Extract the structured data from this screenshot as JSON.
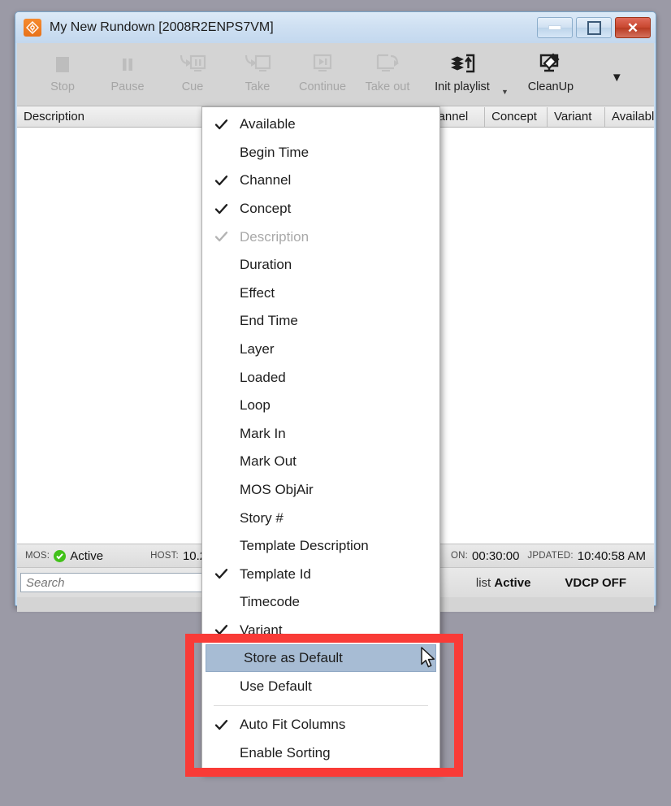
{
  "window": {
    "title": "My New Rundown [2008R2ENPS7VM]",
    "icon": "app-logo-icon",
    "controls": {
      "minimize": "minimize-button",
      "maximize": "maximize-button",
      "close": "close-button"
    }
  },
  "toolbar": {
    "items": [
      {
        "label": "Stop",
        "icon": "stop-icon",
        "enabled": false
      },
      {
        "label": "Pause",
        "icon": "pause-icon",
        "enabled": false
      },
      {
        "label": "Cue",
        "icon": "cue-icon",
        "enabled": false
      },
      {
        "label": "Take",
        "icon": "take-icon",
        "enabled": false
      },
      {
        "label": "Continue",
        "icon": "continue-icon",
        "enabled": false
      },
      {
        "label": "Take out",
        "icon": "take-out-icon",
        "enabled": false
      },
      {
        "label": "Init playlist",
        "icon": "init-playlist-icon",
        "enabled": true
      },
      {
        "label": "CleanUp",
        "icon": "cleanup-icon",
        "enabled": true
      }
    ],
    "overflow_caret": "▼",
    "small_caret": "▼"
  },
  "grid": {
    "columns": [
      "Description",
      "Channel",
      "Concept",
      "Variant",
      "Available"
    ],
    "rows": []
  },
  "status": {
    "mos_key": "MOS:",
    "mos_value": "Active",
    "mos_icon": "green-check-icon",
    "host_key": "HOST:",
    "host_value": "10.2",
    "duration_key": "ON:",
    "duration_value": "00:30:00",
    "updated_key": "JPDATED:",
    "updated_value": "10:40:58 AM"
  },
  "search": {
    "placeholder": "Search",
    "value": "",
    "playlist_prefix": "list",
    "playlist_state": "Active",
    "vdcp_state": "VDCP OFF"
  },
  "context_menu": {
    "items": [
      {
        "label": "Available",
        "checked": true,
        "dim": false
      },
      {
        "label": "Begin Time",
        "checked": false,
        "dim": false
      },
      {
        "label": "Channel",
        "checked": true,
        "dim": false
      },
      {
        "label": "Concept",
        "checked": true,
        "dim": false
      },
      {
        "label": "Description",
        "checked": true,
        "dim": true
      },
      {
        "label": "Duration",
        "checked": false,
        "dim": false
      },
      {
        "label": "Effect",
        "checked": false,
        "dim": false
      },
      {
        "label": "End Time",
        "checked": false,
        "dim": false
      },
      {
        "label": "Layer",
        "checked": false,
        "dim": false
      },
      {
        "label": "Loaded",
        "checked": false,
        "dim": false
      },
      {
        "label": "Loop",
        "checked": false,
        "dim": false
      },
      {
        "label": "Mark In",
        "checked": false,
        "dim": false
      },
      {
        "label": "Mark Out",
        "checked": false,
        "dim": false
      },
      {
        "label": "MOS ObjAir",
        "checked": false,
        "dim": false
      },
      {
        "label": "Story #",
        "checked": false,
        "dim": false
      },
      {
        "label": "Template Description",
        "checked": false,
        "dim": false
      },
      {
        "label": "Template Id",
        "checked": true,
        "dim": false
      },
      {
        "label": "Timecode",
        "checked": false,
        "dim": false
      },
      {
        "label": "Variant",
        "checked": true,
        "dim": false
      },
      {
        "label": "Store as Default",
        "checked": false,
        "dim": false,
        "highlighted": true
      },
      {
        "label": "Use Default",
        "checked": false,
        "dim": false
      },
      {
        "separator_after": true
      },
      {
        "label": "Auto Fit Columns",
        "checked": true,
        "dim": false
      },
      {
        "label": "Enable Sorting",
        "checked": false,
        "dim": false
      }
    ]
  },
  "annotation": {
    "highlight_color": "#f93b37",
    "name": "red-highlight-box"
  },
  "colors": {
    "accent": "#f58a2e",
    "selection": "#a7bcd4",
    "status_ok": "#41c119",
    "page_background": "#9b9aa6"
  },
  "cursor": {
    "name": "mouse-pointer"
  }
}
